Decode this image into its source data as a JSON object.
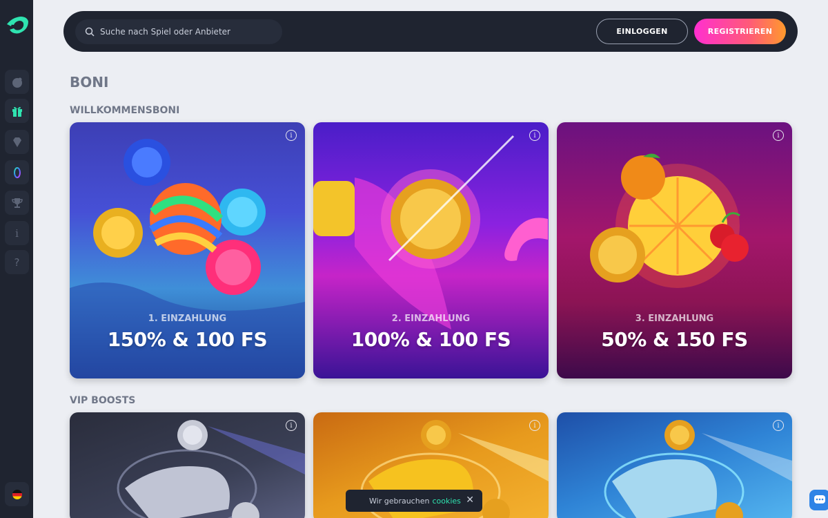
{
  "header": {
    "search_placeholder": "Suche nach Spiel oder Anbieter",
    "login_label": "EINLOGGEN",
    "register_label": "REGISTRIEREN"
  },
  "page": {
    "title": "BONI"
  },
  "sections": {
    "welcome_title": "WILLKOMMENSBONI",
    "vip_title": "VIP BOOSTS"
  },
  "welcome_cards": [
    {
      "deposit": "1. EINZAHLUNG",
      "amount": "150% & 100 FS"
    },
    {
      "deposit": "2. EINZAHLUNG",
      "amount": "100% & 100 FS"
    },
    {
      "deposit": "3. EINZAHLUNG",
      "amount": "50% & 150 FS"
    }
  ],
  "info_symbol": "i",
  "sidebar": {
    "items": [
      "casino-chip-icon",
      "gift-icon",
      "diamond-icon",
      "loyalty-ring-icon",
      "trophy-icon",
      "info-icon",
      "help-icon",
      "germany-flag-icon"
    ],
    "info_glyph": "i",
    "help_glyph": "?"
  },
  "cookie_bar": {
    "text": "Wir gebrauchen",
    "link": "cookies",
    "close": "✕"
  },
  "colors": {
    "accent": "#2fe3b0",
    "sidebar_bg": "#1f2430",
    "page_bg": "#eceef3"
  }
}
